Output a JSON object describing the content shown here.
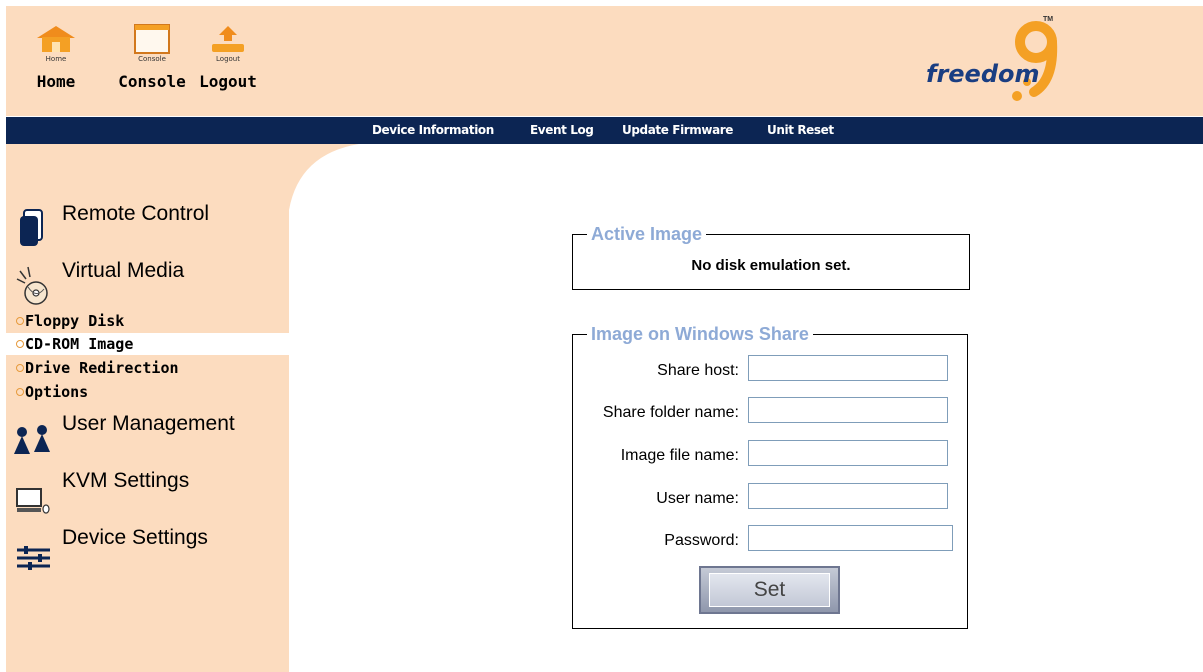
{
  "toolbar": {
    "home": {
      "small": "Home",
      "label": "Home"
    },
    "console": {
      "small": "Console",
      "label": "Console"
    },
    "logout": {
      "small": "Logout",
      "label": "Logout"
    }
  },
  "brand": {
    "word": "freedom",
    "digit": "9",
    "tm": "TM"
  },
  "nav": [
    "Device Information",
    "Event Log",
    "Update Firmware",
    "Unit Reset"
  ],
  "sidebar": {
    "sections": [
      {
        "label": "Remote Control",
        "icon": "remote-control-icon"
      },
      {
        "label": "Virtual Media",
        "icon": "cd-disc-icon"
      },
      {
        "label": "User Management",
        "icon": "users-icon"
      },
      {
        "label": "KVM Settings",
        "icon": "computer-icon"
      },
      {
        "label": "Device Settings",
        "icon": "sliders-icon"
      }
    ],
    "virtual_media_items": [
      {
        "label": "Floppy Disk",
        "active": false
      },
      {
        "label": "CD-ROM Image",
        "active": true
      },
      {
        "label": "Drive Redirection",
        "active": false
      },
      {
        "label": "Options",
        "active": false
      }
    ]
  },
  "active_image": {
    "legend": "Active Image",
    "message": "No disk emulation set."
  },
  "windows_share": {
    "legend": "Image on Windows Share",
    "fields": [
      {
        "label": "Share host:",
        "value": ""
      },
      {
        "label": "Share folder name:",
        "value": ""
      },
      {
        "label": "Image file name:",
        "value": ""
      },
      {
        "label": "User name:",
        "value": ""
      },
      {
        "label": "Password:",
        "value": ""
      }
    ],
    "set_label": "Set"
  },
  "colors": {
    "panel_bg": "#fcdcbf",
    "nav_bg": "#0c2553",
    "legend": "#8eaad6",
    "brand_blue": "#1a3e82",
    "brand_orange": "#f4a024"
  }
}
